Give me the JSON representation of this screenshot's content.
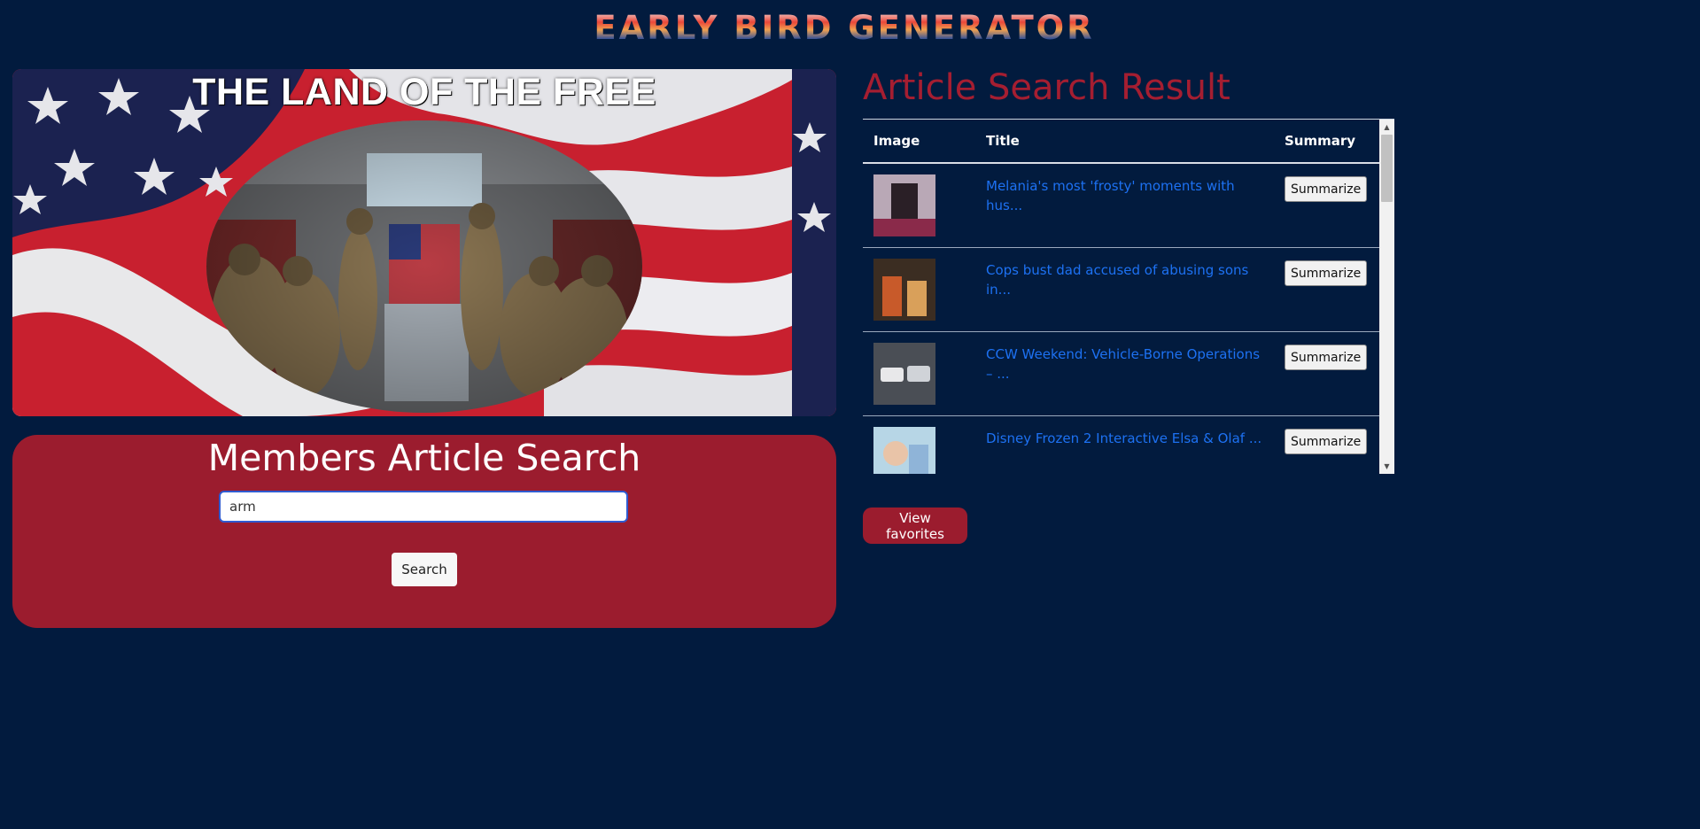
{
  "site": {
    "title": "EARLY BIRD GENERATOR"
  },
  "hero": {
    "title": "THE LAND OF THE FREE"
  },
  "search": {
    "heading": "Members Article Search",
    "value": "arm",
    "button_label": "Search"
  },
  "results": {
    "heading": "Article Search Result",
    "columns": [
      "Image",
      "Title",
      "Summary"
    ],
    "rows": [
      {
        "title": "Melania's most 'frosty' moments with hus...",
        "button": "Summarize"
      },
      {
        "title": "Cops bust dad accused of abusing sons in...",
        "button": "Summarize"
      },
      {
        "title": "CCW Weekend: Vehicle-Borne Operations – ...",
        "button": "Summarize"
      },
      {
        "title": "Disney Frozen 2 Interactive Elsa & Olaf ...",
        "button": "Summarize"
      }
    ]
  },
  "favorites": {
    "button_label": "View favorites"
  },
  "colors": {
    "background": "#021b3e",
    "accent_red": "#9b1c2e",
    "heading_red": "#a51e31",
    "link_blue": "#1d71f2"
  }
}
